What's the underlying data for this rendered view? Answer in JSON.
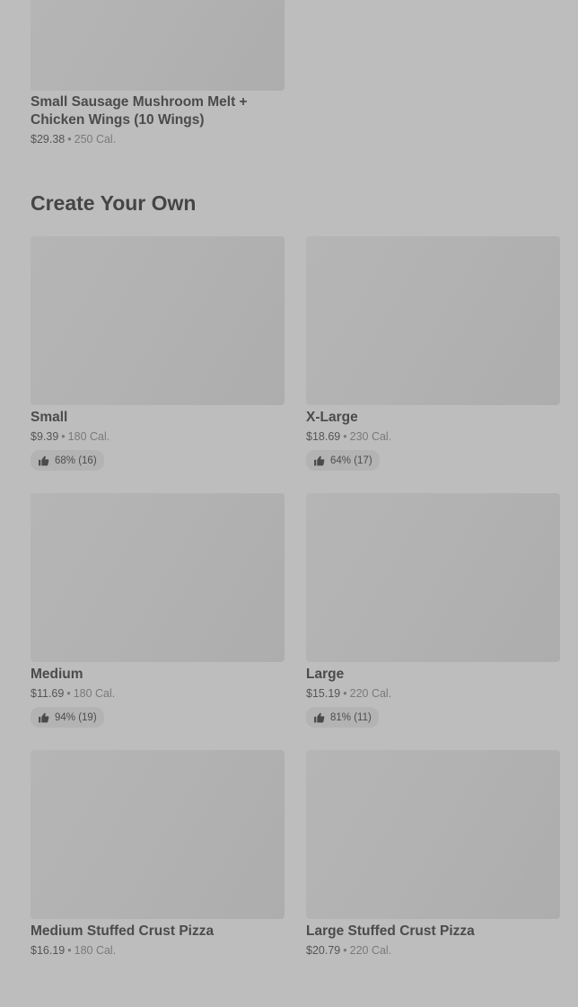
{
  "top_item": {
    "title": "Small Sausage Mushroom Melt + Chicken Wings (10 Wings)",
    "price": "$29.38",
    "separator": "•",
    "calories": "250 Cal."
  },
  "section": {
    "title": "Create Your Own"
  },
  "items": [
    {
      "title": "Small",
      "price": "$9.39",
      "separator": "•",
      "calories": "180 Cal.",
      "rating": "68% (16)"
    },
    {
      "title": "X-Large",
      "price": "$18.69",
      "separator": "•",
      "calories": "230 Cal.",
      "rating": "64% (17)"
    },
    {
      "title": "Medium",
      "price": "$11.69",
      "separator": "•",
      "calories": "180 Cal.",
      "rating": "94% (19)"
    },
    {
      "title": "Large",
      "price": "$15.19",
      "separator": "•",
      "calories": "220 Cal.",
      "rating": "81% (11)"
    },
    {
      "title": "Medium Stuffed Crust Pizza",
      "price": "$16.19",
      "separator": "•",
      "calories": "180 Cal."
    },
    {
      "title": "Large Stuffed Crust Pizza",
      "price": "$20.79",
      "separator": "•",
      "calories": "220 Cal."
    }
  ],
  "icons": {
    "rating": "thumbs-up-icon"
  }
}
